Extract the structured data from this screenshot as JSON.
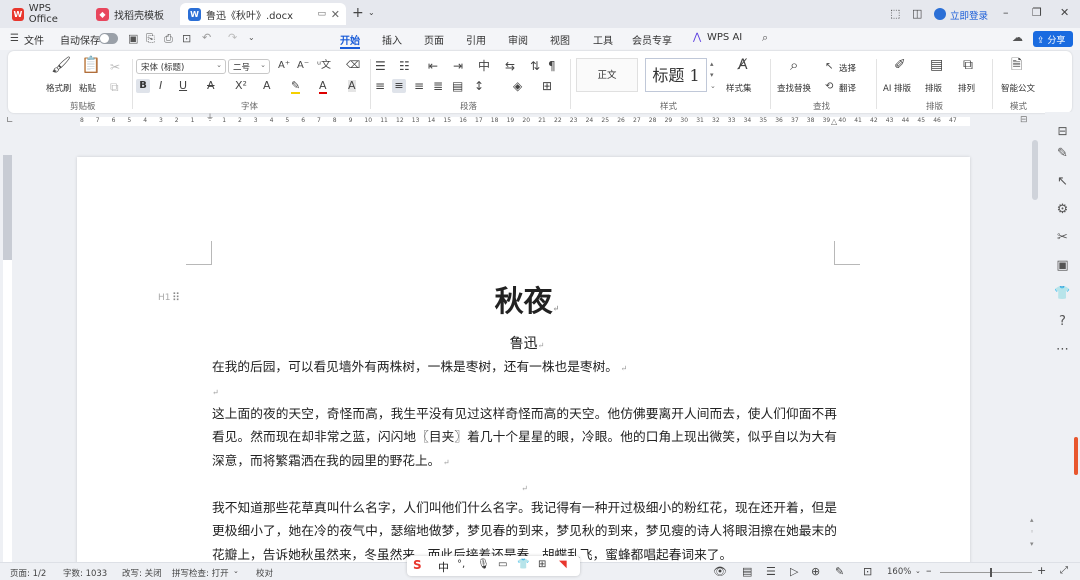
{
  "titlebar": {
    "tabs": [
      {
        "label": "WPS Office",
        "icon": "wps-logo-icon"
      },
      {
        "label": "找稻壳模板",
        "icon": "docer-icon"
      },
      {
        "label": "鲁迅《秋叶》.docx",
        "icon": "word-doc-icon"
      }
    ],
    "login_label": "立即登录"
  },
  "menubar": {
    "file_label": "文件",
    "autosave_label": "自动保存",
    "tabs": [
      "开始",
      "插入",
      "页面",
      "引用",
      "审阅",
      "视图",
      "工具",
      "会员专享",
      "WPS AI"
    ],
    "active_tab": "开始",
    "share_label": "分享"
  },
  "ribbon": {
    "clipboard": {
      "format_painter": "格式刷",
      "paste": "粘贴",
      "group_label": "剪贴板"
    },
    "font": {
      "font_name": "宋体 (标题)",
      "font_size": "二号",
      "group_label": "字体"
    },
    "paragraph": {
      "group_label": "段落"
    },
    "styles": {
      "style_normal": "正文",
      "style_heading": "标题  1",
      "style_set": "样式集",
      "group_label": "样式"
    },
    "find": {
      "find_replace": "查找替换",
      "select": "选择",
      "translate": "翻译",
      "group_label": "查找"
    },
    "layout": {
      "ai_layout": "AI 排版",
      "typeset": "排版",
      "arrange": "排列",
      "group_label": "排版"
    },
    "mode": {
      "smart_doc": "智能公文",
      "group_label": "模式"
    }
  },
  "ruler": {
    "ticks": [
      "8",
      "7",
      "6",
      "5",
      "4",
      "3",
      "2",
      "1",
      "",
      "1",
      "2",
      "3",
      "4",
      "5",
      "6",
      "7",
      "8",
      "9",
      "10",
      "11",
      "12",
      "13",
      "14",
      "15",
      "16",
      "17",
      "18",
      "19",
      "20",
      "21",
      "22",
      "23",
      "24",
      "25",
      "26",
      "27",
      "28",
      "29",
      "30",
      "31",
      "32",
      "33",
      "34",
      "35",
      "36",
      "37",
      "38",
      "39",
      "40",
      "41",
      "42",
      "43",
      "44",
      "45",
      "46",
      "47"
    ]
  },
  "document": {
    "heading_marker": "H1",
    "title": "秋夜",
    "author": "鲁迅",
    "paragraphs": [
      "在我的后园，可以看见墙外有两株树，一株是枣树，还有一株也是枣树。",
      "",
      "这上面的夜的天空，奇怪而高，我生平没有见过这样奇怪而高的天空。他仿佛要离开人间而去，使人们仰面不再看见。然而现在却非常之蓝，闪闪地〖目夹〗着几十个星星的眼，冷眼。他的口角上现出微笑，似乎自以为大有深意，而将繁霜洒在我的园里的野花上。",
      "",
      "我不知道那些花草真叫什么名字，人们叫他们什么名字。我记得有一种开过极细小的粉红花，现在还开着，但是更极细小了，她在冷的夜气中，瑟缩地做梦，梦见春的到来，梦见秋的到来，梦见瘦的诗人将眼泪擦在她最末的花瓣上，告诉她秋虽然来，冬虽然来，而此后接着还是春，胡蝶乱飞，蜜蜂都唱起春词来了。"
    ]
  },
  "statusbar": {
    "page": "页面: 1/2",
    "word_count": "字数: 1033",
    "revision": "改写: 关闭",
    "spellcheck": "拼写检查: 打开",
    "proofread": "校对",
    "ime_label": "中",
    "zoom": "160%"
  },
  "colors": {
    "accent": "#1a5cd8",
    "wps_red": "#e8362d",
    "doc_blue": "#2b6fd6"
  }
}
